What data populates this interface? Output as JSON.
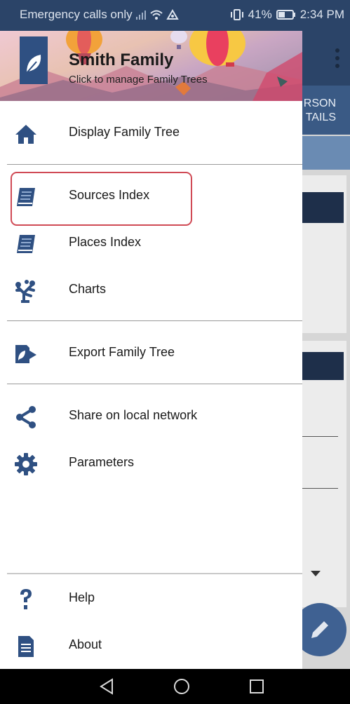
{
  "status_bar": {
    "carrier": "Emergency calls only",
    "battery": "41%",
    "time": "2:34 PM"
  },
  "drawer": {
    "header": {
      "title": "Smith Family",
      "subtitle": "Click to manage Family Trees"
    },
    "items": [
      {
        "label": "Display Family Tree",
        "icon": "home-icon"
      },
      {
        "label": "Sources Index",
        "icon": "book-icon"
      },
      {
        "label": "Places Index",
        "icon": "book-icon"
      },
      {
        "label": "Charts",
        "icon": "tree-icon"
      },
      {
        "label": "Export Family Tree",
        "icon": "export-icon"
      },
      {
        "label": "Share on local network",
        "icon": "share-icon"
      },
      {
        "label": "Parameters",
        "icon": "gear-icon"
      },
      {
        "label": "Help",
        "icon": "help-icon"
      },
      {
        "label": "About",
        "icon": "document-icon"
      }
    ]
  },
  "background_app": {
    "tab_label_line1": "RSON",
    "tab_label_line2": "TAILS"
  },
  "colors": {
    "primary": "#2b4468",
    "icon": "#2f5082",
    "highlight": "#d04a55"
  }
}
